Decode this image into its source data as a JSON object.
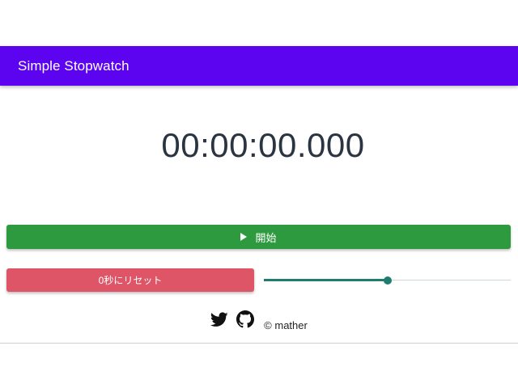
{
  "app": {
    "title": "Simple Stopwatch",
    "accent_color": "#5c04f0"
  },
  "timer": {
    "display": "00:00:00.000"
  },
  "controls": {
    "start_label": "開始",
    "start_icon": "play-icon",
    "start_color": "#2e9a3f",
    "reset_label": "0秒にリセット",
    "reset_color": "#dd5566",
    "slider_value_fraction": 0.5,
    "slider_color": "#1f7d6e"
  },
  "footer": {
    "icons": [
      "twitter-icon",
      "github-icon"
    ],
    "credit": "© mather"
  }
}
